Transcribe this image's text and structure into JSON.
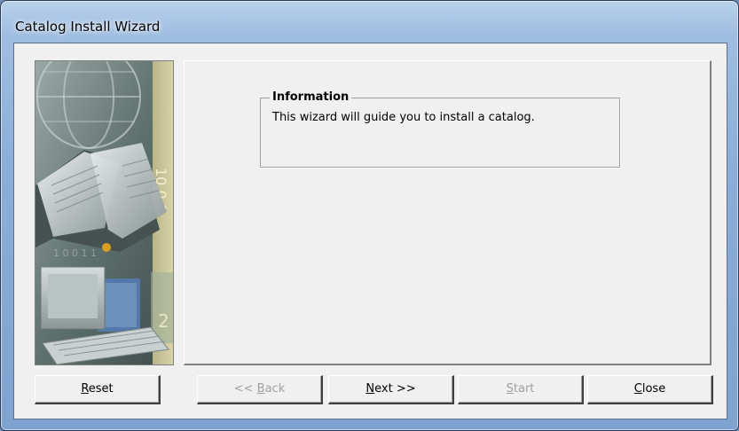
{
  "window": {
    "title": "Catalog Install Wizard"
  },
  "info_group": {
    "legend": "Information",
    "text": "This wizard will guide you to install a catalog."
  },
  "buttons": {
    "reset": {
      "accel": "R",
      "rest": "eset"
    },
    "back": {
      "prefix": "<< ",
      "accel": "B",
      "rest": "ack"
    },
    "next": {
      "accel": "N",
      "rest": "ext >>"
    },
    "start": {
      "accel": "S",
      "rest": "tart"
    },
    "close": {
      "accel": "C",
      "rest": "lose"
    }
  },
  "icons": {
    "sidebar": "wizard-banner-image"
  },
  "colors": {
    "title_glass": "#8aaed8",
    "dialog_face": "#f0f0f0",
    "disabled_text": "#a0a0a0"
  }
}
